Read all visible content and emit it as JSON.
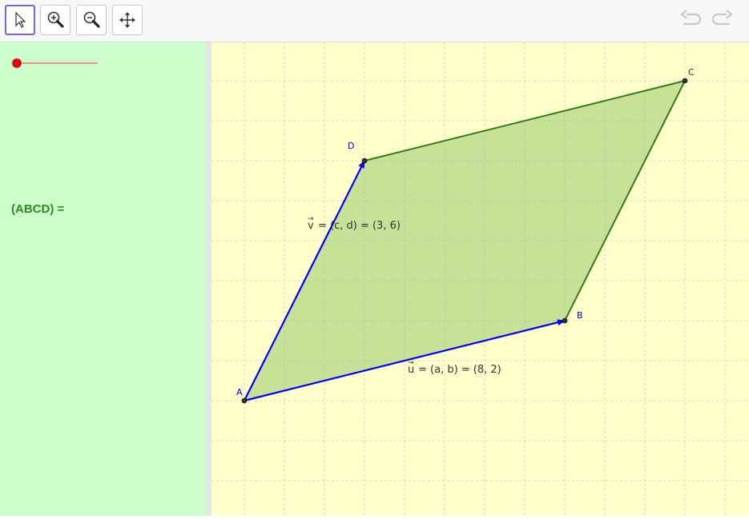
{
  "toolbar": {
    "tools": [
      {
        "name": "move",
        "icon": "cursor-arrow-icon",
        "selected": true
      },
      {
        "name": "zoom-in",
        "icon": "zoom-in-icon",
        "selected": false
      },
      {
        "name": "zoom-out",
        "icon": "zoom-out-icon",
        "selected": false
      },
      {
        "name": "move-graphics-view",
        "icon": "move-arrows-icon",
        "selected": false
      }
    ],
    "undo_icon": "undo-icon",
    "redo_icon": "redo-icon"
  },
  "algebra": {
    "area_label": "(ABCD) =",
    "slider": {
      "value": 0,
      "color": "#ff0000"
    }
  },
  "graphics": {
    "grid_step": 1,
    "origin_label": "A",
    "points": [
      {
        "label": "A",
        "x": 0,
        "y": 0
      },
      {
        "label": "B",
        "x": 8,
        "y": 2
      },
      {
        "label": "C",
        "x": 11,
        "y": 8
      },
      {
        "label": "D",
        "x": 3,
        "y": 6
      }
    ],
    "vectors": {
      "u": {
        "symbol": "u",
        "text": "= (a, b) = (8, 2)",
        "components": [
          8,
          2
        ]
      },
      "v": {
        "symbol": "v",
        "text": "= (c, d) = (3, 6)",
        "components": [
          3,
          6
        ]
      }
    },
    "colors": {
      "background": "#ffffcc",
      "grid": "#cccccc",
      "vector": "#0000ff",
      "polygon_fill": "#8fc460",
      "polygon_edge": "#2e7d16",
      "point_label": "#0000cc"
    }
  }
}
